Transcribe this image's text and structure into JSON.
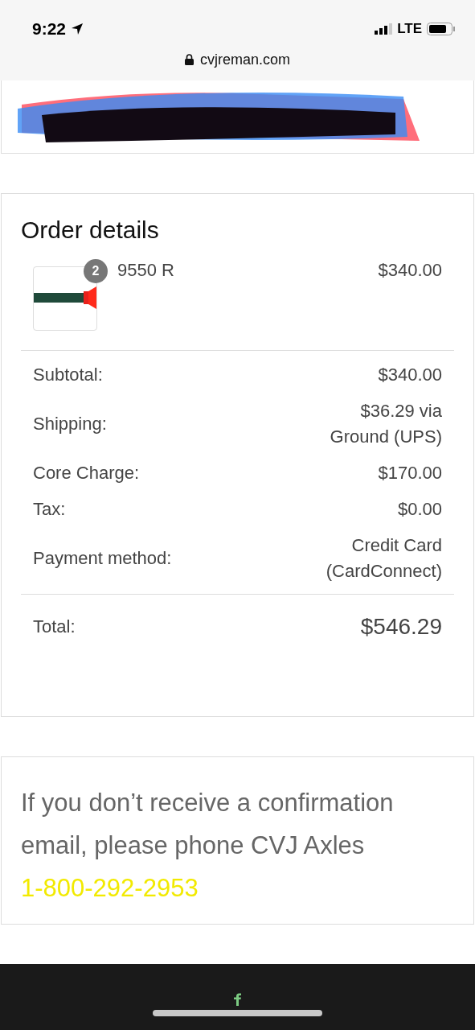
{
  "status_bar": {
    "time": "9:22",
    "network": "LTE"
  },
  "browser": {
    "url": "cvjreman.com"
  },
  "order": {
    "title": "Order details",
    "items": [
      {
        "quantity": "2",
        "name": "9550 R",
        "price": "$340.00"
      }
    ],
    "totals": [
      {
        "label": "Subtotal:",
        "value": "$340.00"
      },
      {
        "label": "Shipping:",
        "value": "$36.29 via Ground (UPS)"
      },
      {
        "label": "Core Charge:",
        "value": "$170.00"
      },
      {
        "label": "Tax:",
        "value": "$0.00"
      },
      {
        "label": "Payment method:",
        "value": "Credit Card (CardConnect)"
      }
    ],
    "total": {
      "label": "Total:",
      "value": "$546.29"
    }
  },
  "notice": {
    "text": "If you don’t receive a confirmation email, please phone CVJ Axles",
    "phone": "1-800-292-2953"
  }
}
